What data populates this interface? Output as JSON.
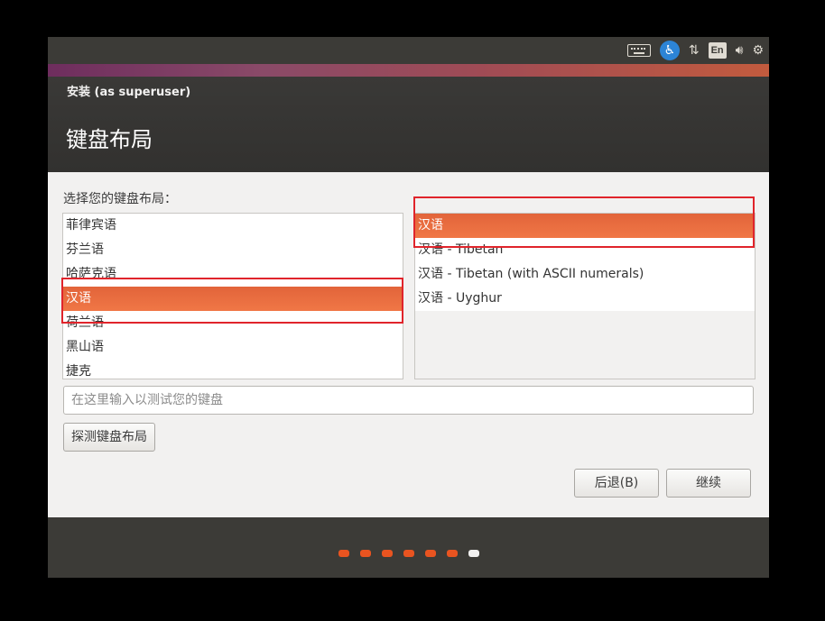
{
  "colors": {
    "accent": "#e95420",
    "highlight_box": "#e0242b",
    "panel_dark": "#3c3b37"
  },
  "topbar": {
    "icons": [
      "keyboard-icon",
      "accessibility-icon",
      "network-icon",
      "language-icon",
      "volume-icon",
      "gear-icon"
    ],
    "language_label": "En"
  },
  "header": {
    "subtitle": "安装 (as superuser)",
    "title": "键盘布局"
  },
  "content": {
    "prompt": "选择您的键盘布局：",
    "left_list": [
      "菲律宾语",
      "芬兰语",
      "哈萨克语",
      "汉语",
      "荷兰语",
      "黑山语",
      "捷克"
    ],
    "left_selected": "汉语",
    "right_list": [
      "汉语",
      "汉语 - Tibetan",
      "汉语 - Tibetan (with ASCII numerals)",
      "汉语 - Uyghur"
    ],
    "right_selected": "汉语",
    "test_input_placeholder": "在这里输入以测试您的键盘",
    "detect_button": "探测键盘布局"
  },
  "buttons": {
    "back": "后退(B)",
    "continue": "继续"
  },
  "progress": {
    "total_steps": 7,
    "current_step": 7
  }
}
